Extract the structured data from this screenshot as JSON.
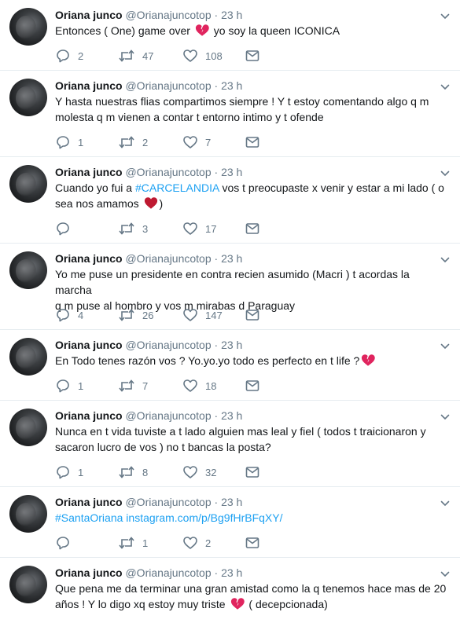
{
  "icons": {
    "reply": "reply-icon",
    "retweet": "retweet-icon",
    "like": "like-icon",
    "dm": "direct-message-icon",
    "caret": "chevron-down-icon"
  },
  "colors": {
    "link": "#1da1f2",
    "muted": "#657786",
    "heart": "#e0245e"
  },
  "tweets": [
    {
      "name": "Oriana junco",
      "handle": "@Orianajuncotop",
      "dot": "·",
      "time": "23 h",
      "line1_a": "Entonces ( One) game over ",
      "line1_b": " yo soy la queen ICONICA",
      "reply": "2",
      "retweet": "47",
      "like": "108"
    },
    {
      "name": "Oriana junco",
      "handle": "@Orianajuncotop",
      "dot": "·",
      "time": "23 h",
      "line1": "Y hasta nuestras flias compartimos siempre ! Y t estoy comentando algo q m",
      "line2": "molesta q m vienen a contar t entorno intimo y t ofende",
      "reply": "1",
      "retweet": "2",
      "like": "7"
    },
    {
      "name": "Oriana junco",
      "handle": "@Orianajuncotop",
      "dot": "·",
      "time": "23 h",
      "line1_a": "Cuando yo fui a ",
      "hashtag": "#CARCELANDIA",
      "line1_b": " vos t preocupaste x venir y estar a mi lado ( o",
      "line2_a": "sea nos amamos ",
      "line2_b": ")",
      "reply": "",
      "retweet": "3",
      "like": "17"
    },
    {
      "name": "Oriana junco",
      "handle": "@Orianajuncotop",
      "dot": "·",
      "time": "23 h",
      "line1": "Yo me puse un presidente en contra recien asumido (Macri ) t acordas la marcha",
      "line2": "q m puse al hombro y vos m mirabas d Paraguay",
      "reply": "4",
      "retweet": "26",
      "like": "147"
    },
    {
      "name": "Oriana junco",
      "handle": "@Orianajuncotop",
      "dot": "·",
      "time": "23 h",
      "line1_a": "En Todo tenes razón vos ? Yo.yo.yo todo es perfecto en t life ?",
      "reply": "1",
      "retweet": "7",
      "like": "18"
    },
    {
      "name": "Oriana junco",
      "handle": "@Orianajuncotop",
      "dot": "·",
      "time": "23 h",
      "line1": "Nunca en t vida tuviste a t lado alguien mas leal y fiel ( todos t traicionaron y",
      "line2": "sacaron lucro de vos ) no t bancas la posta?",
      "reply": "1",
      "retweet": "8",
      "like": "32"
    },
    {
      "name": "Oriana junco",
      "handle": "@Orianajuncotop",
      "dot": "·",
      "time": "23 h",
      "hashtag": "#SantaOriana",
      "url": "instagram.com/p/Bg9fHrBFqXY/",
      "reply": "",
      "retweet": "1",
      "like": "2"
    },
    {
      "name": "Oriana junco",
      "handle": "@Orianajuncotop",
      "dot": "·",
      "time": "23 h",
      "line1": "Que pena me da terminar una gran amistad como la q tenemos hace mas de 20",
      "line2_a": "años ! Y lo digo xq estoy muy triste ",
      "line2_b": " ( decepcionada)"
    }
  ]
}
